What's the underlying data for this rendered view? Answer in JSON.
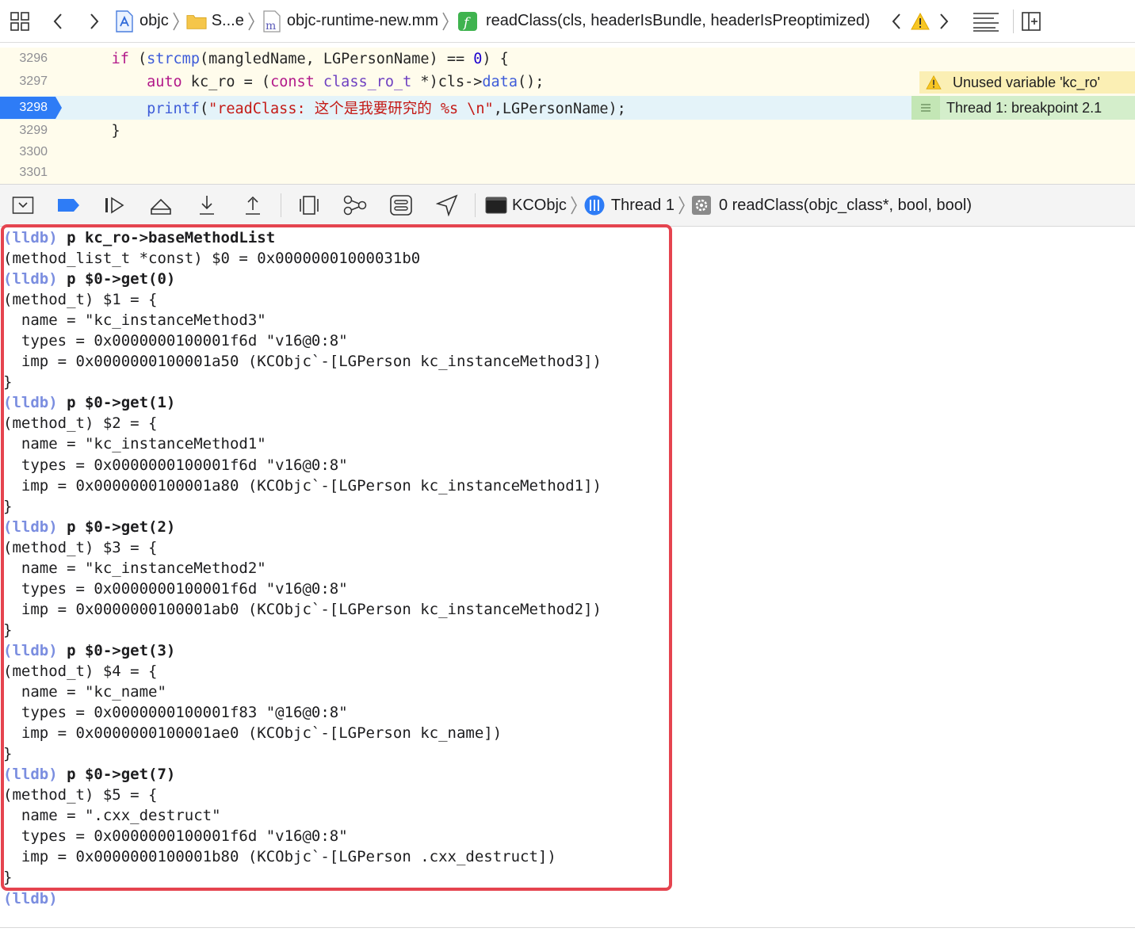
{
  "jumpbar": {
    "project": "objc",
    "group": "S...e",
    "file": "objc-runtime-new.mm",
    "file_letter": "m",
    "function_letter": "f",
    "function": "readClass(cls, headerIsBundle, headerIsPreoptimized)",
    "icons": [
      "grid-icon",
      "back-chevron-icon",
      "forward-chevron-icon",
      "project-icon",
      "folder-icon",
      "file-m-icon",
      "function-f-icon",
      "prev-issue-icon",
      "warning-icon",
      "next-issue-icon",
      "lines-icon",
      "add-editor-icon"
    ]
  },
  "editor": {
    "lines": [
      {
        "number": "3296",
        "tokens": [
          [
            "pl",
            "    "
          ],
          [
            "kw",
            "if"
          ],
          [
            "pl",
            " ("
          ],
          [
            "fn",
            "strcmp"
          ],
          [
            "pl",
            "(mangledName, LGPersonName) == "
          ],
          [
            "num",
            "0"
          ],
          [
            "pl",
            ") {"
          ]
        ]
      },
      {
        "number": "3297",
        "tokens": [
          [
            "pl",
            "        "
          ],
          [
            "kw",
            "auto"
          ],
          [
            "pl",
            " kc_ro = ("
          ],
          [
            "kw",
            "const"
          ],
          [
            "pl",
            " "
          ],
          [
            "ty",
            "class_ro_t"
          ],
          [
            "pl",
            " *)cls->"
          ],
          [
            "fn",
            "data"
          ],
          [
            "pl",
            "();"
          ]
        ]
      },
      {
        "number": "3298",
        "tokens": [
          [
            "pl",
            "        "
          ],
          [
            "fn",
            "printf"
          ],
          [
            "pl",
            "("
          ],
          [
            "str",
            "\"readClass: 这个是我要研究的 %s \\n\""
          ],
          [
            "pl",
            ",LGPersonName);"
          ]
        ]
      },
      {
        "number": "3299",
        "tokens": [
          [
            "pl",
            "    }"
          ]
        ]
      },
      {
        "number": "3300",
        "tokens": []
      },
      {
        "number": "3301",
        "tokens": []
      }
    ],
    "warning_text": "Unused variable 'kc_ro'",
    "breakpoint_text": "Thread 1: breakpoint 2.1",
    "colors": {
      "editor_bg": "#fffcec",
      "breakpoint_blue": "#2e7cf6",
      "warning_bg": "#fbefb4",
      "breakpoint_bg": "#d4eecb"
    }
  },
  "debugbar": {
    "icons": [
      "hide-console-icon",
      "breakpoint-toggle-icon",
      "continue-icon",
      "step-over-icon",
      "step-into-icon",
      "step-out-icon",
      "view-hierarchy-icon",
      "memory-graph-icon",
      "environment-icon",
      "location-icon"
    ],
    "target": "KCObjc",
    "thread": "Thread 1",
    "frame": "0 readClass(objc_class*, bool, bool)"
  },
  "console": {
    "lines": [
      {
        "prompt": "(lldb)",
        "cmd": " p kc_ro->baseMethodList"
      },
      {
        "text": "(method_list_t *const) $0 = 0x00000001000031b0"
      },
      {
        "prompt": "(lldb)",
        "cmd": " p $0->get(0)"
      },
      {
        "text": "(method_t) $1 = {"
      },
      {
        "text": "  name = \"kc_instanceMethod3\""
      },
      {
        "text": "  types = 0x0000000100001f6d \"v16@0:8\""
      },
      {
        "text": "  imp = 0x0000000100001a50 (KCObjc`-[LGPerson kc_instanceMethod3])"
      },
      {
        "text": "}"
      },
      {
        "prompt": "(lldb)",
        "cmd": " p $0->get(1)"
      },
      {
        "text": "(method_t) $2 = {"
      },
      {
        "text": "  name = \"kc_instanceMethod1\""
      },
      {
        "text": "  types = 0x0000000100001f6d \"v16@0:8\""
      },
      {
        "text": "  imp = 0x0000000100001a80 (KCObjc`-[LGPerson kc_instanceMethod1])"
      },
      {
        "text": "}"
      },
      {
        "prompt": "(lldb)",
        "cmd": " p $0->get(2)"
      },
      {
        "text": "(method_t) $3 = {"
      },
      {
        "text": "  name = \"kc_instanceMethod2\""
      },
      {
        "text": "  types = 0x0000000100001f6d \"v16@0:8\""
      },
      {
        "text": "  imp = 0x0000000100001ab0 (KCObjc`-[LGPerson kc_instanceMethod2])"
      },
      {
        "text": "}"
      },
      {
        "prompt": "(lldb)",
        "cmd": " p $0->get(3)"
      },
      {
        "text": "(method_t) $4 = {"
      },
      {
        "text": "  name = \"kc_name\""
      },
      {
        "text": "  types = 0x0000000100001f83 \"@16@0:8\""
      },
      {
        "text": "  imp = 0x0000000100001ae0 (KCObjc`-[LGPerson kc_name])"
      },
      {
        "text": "}"
      },
      {
        "prompt": "(lldb)",
        "cmd": " p $0->get(7)"
      },
      {
        "text": "(method_t) $5 = {"
      },
      {
        "text": "  name = \".cxx_destruct\""
      },
      {
        "text": "  types = 0x0000000100001f6d \"v16@0:8\""
      },
      {
        "text": "  imp = 0x0000000100001b80 (KCObjc`-[LGPerson .cxx_destruct])"
      },
      {
        "text": "}"
      },
      {
        "prompt": "(lldb)",
        "cmd": ""
      }
    ],
    "colors": {
      "prompt": "#7b8ee0",
      "highlight_box": "#e5444f"
    }
  }
}
